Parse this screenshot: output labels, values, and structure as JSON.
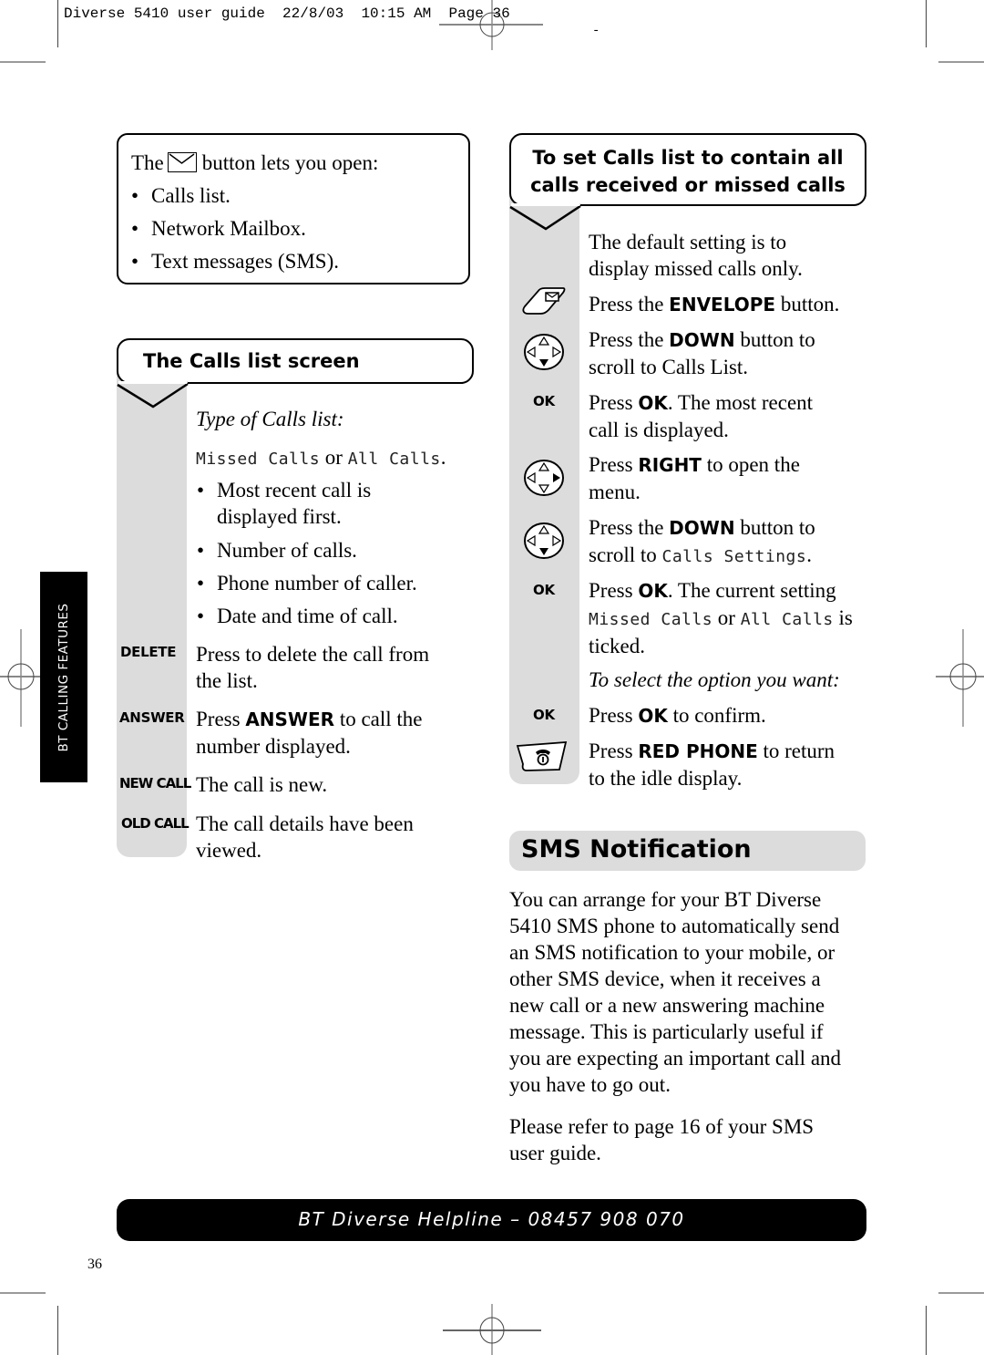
{
  "slug": {
    "text": "Diverse 5410 user guide  22/8/03  10:15 AM  Page 36",
    "dash": "-"
  },
  "intro_box": {
    "line_pre": "The",
    "icon": "envelope-icon",
    "line_post": "button lets you open:",
    "items": [
      "Calls list.",
      "Network Mailbox.",
      "Text messages (SMS)."
    ]
  },
  "calls_list_section": {
    "title": "The Calls list screen",
    "type_label": "Type of Calls list:",
    "lcd_missed": "Missed Calls",
    "or_word": "or",
    "lcd_all": "All Calls",
    "period": ".",
    "bullets": [
      {
        "l1": "Most recent call is",
        "l2": "displayed first."
      },
      {
        "l1": "Number of calls.",
        "l2": ""
      },
      {
        "l1": "Phone number of caller.",
        "l2": ""
      },
      {
        "l1": "Date and time of call.",
        "l2": ""
      }
    ],
    "keys": [
      {
        "key": "DELETE",
        "l1": "Press to delete the call from",
        "l2": "the list."
      },
      {
        "key": "ANSWER",
        "l1_pre": "Press ",
        "l1_bold": "ANSWER",
        "l1_post": " to call the",
        "l2": "number displayed."
      },
      {
        "key": "NEW CALL",
        "l1": "The call is new."
      },
      {
        "key": "OLD CALL",
        "l1": "The call details have been",
        "l2": "viewed."
      }
    ]
  },
  "side_tab": {
    "label": "BT CALLING FEATURES"
  },
  "set_calls_section": {
    "title_l1": "To set Calls list to contain all",
    "title_l2": "calls received or missed calls",
    "default_l1": "The default setting is to",
    "default_l2": "display missed calls only.",
    "steps": [
      {
        "icon": "envelope-button-icon",
        "pre": "Press the ",
        "bold": "ENVELOPE",
        "post": " button."
      },
      {
        "icon": "navigation-down-icon",
        "pre": "Press the ",
        "bold": "DOWN",
        "post": " button to",
        "l2": "scroll to Calls List."
      },
      {
        "key": "OK",
        "pre": "Press ",
        "bold": "OK",
        "post": ". The most recent",
        "l2": "call is displayed."
      },
      {
        "icon": "navigation-right-icon",
        "pre": "Press ",
        "bold": "RIGHT",
        "post": " to open the",
        "l2": "menu."
      },
      {
        "icon": "navigation-down-icon",
        "pre": "Press the ",
        "bold": "DOWN",
        "post": " button to",
        "l2_pre": "scroll to ",
        "l2_lcd": "Calls Settings",
        "l2_post": "."
      },
      {
        "key": "OK",
        "pre": "Press ",
        "bold": "OK",
        "post": ". The current setting",
        "l2_lcd1": "Missed Calls",
        "l2_mid": " or ",
        "l2_lcd2": "All Calls",
        "l2_post": " is",
        "l3": "ticked."
      },
      {
        "italic": "To select the option you want:"
      },
      {
        "key": "OK",
        "pre": "Press ",
        "bold": "OK",
        "post": " to confirm."
      },
      {
        "icon": "red-phone-button-icon",
        "pre": "Press ",
        "bold": "RED PHONE",
        "post": " to return",
        "l2": "to the idle display."
      }
    ]
  },
  "sms_section": {
    "title": "SMS Notification",
    "para1": [
      "You can arrange for your BT Diverse",
      "5410 SMS phone to automatically send",
      "an SMS notification to your mobile, or",
      "other SMS device, when it receives a",
      "new call or a new answering machine",
      "message. This is particularly useful if",
      "you are expecting an important call and",
      "you have to go out."
    ],
    "para2": [
      "Please refer to page 16 of your SMS",
      "user guide."
    ]
  },
  "helpline": {
    "text": "BT Diverse Helpline – 08457 908 070"
  },
  "page_number": "36"
}
